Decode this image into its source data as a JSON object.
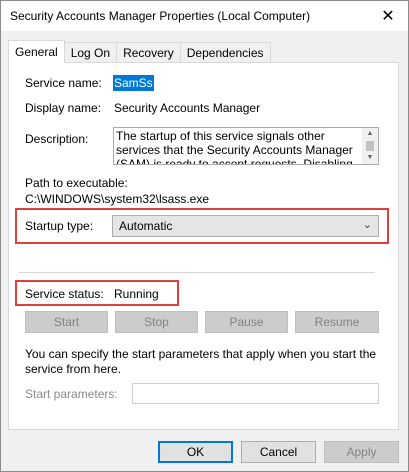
{
  "window": {
    "title": "Security Accounts Manager Properties (Local Computer)",
    "close_glyph": "✕"
  },
  "tabs": [
    {
      "label": "General",
      "active": true
    },
    {
      "label": "Log On",
      "active": false
    },
    {
      "label": "Recovery",
      "active": false
    },
    {
      "label": "Dependencies",
      "active": false
    }
  ],
  "general": {
    "service_name_label": "Service name:",
    "service_name_value": "SamSs",
    "display_name_label": "Display name:",
    "display_name_value": "Security Accounts Manager",
    "description_label": "Description:",
    "description_value": "The startup of this service signals other services that the Security Accounts Manager (SAM) is ready to accept requests.  Disabling this service will prevent other services in the system from being notified when the SAM is ready, which may in turn cause those services to fail to start correctly.",
    "path_label": "Path to executable:",
    "path_value": "C:\\WINDOWS\\system32\\lsass.exe",
    "startup_type_label": "Startup type:",
    "startup_type_value": "Automatic",
    "service_status_label": "Service status:",
    "service_status_value": "Running",
    "start_button": "Start",
    "stop_button": "Stop",
    "pause_button": "Pause",
    "resume_button": "Resume",
    "help_text": "You can specify the start parameters that apply when you start the service from here.",
    "start_params_label": "Start parameters:",
    "start_params_value": ""
  },
  "footer": {
    "ok_button": "OK",
    "cancel_button": "Cancel",
    "apply_button": "Apply"
  },
  "colors": {
    "highlight": "#0078d7",
    "annotation_red": "#e0403a"
  },
  "icons": {
    "close": "close-icon",
    "dropdown": "chevron-down-icon",
    "scroll_up": "scroll-up-arrow-icon",
    "scroll_down": "scroll-down-arrow-icon"
  }
}
